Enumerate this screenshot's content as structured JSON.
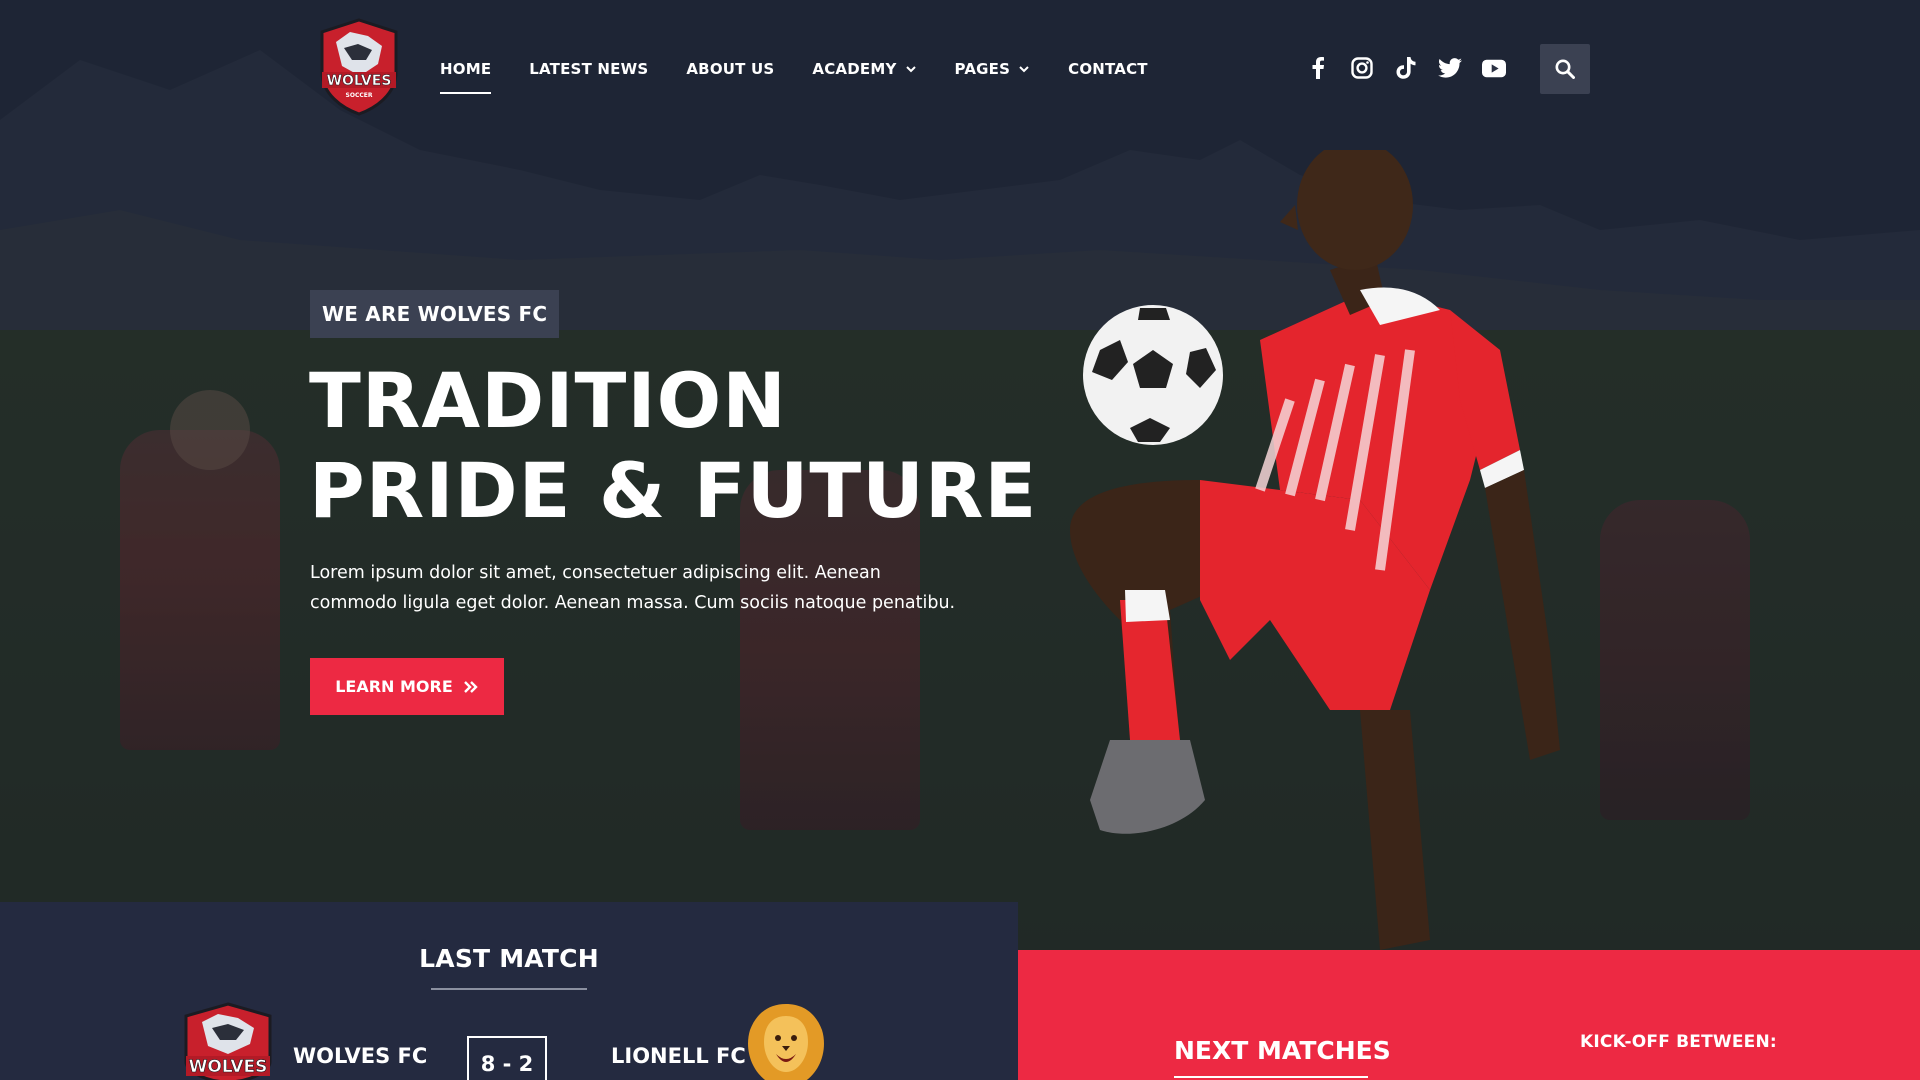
{
  "brand": {
    "logo_text": "WOLVES",
    "logo_subtext": "SOCCER",
    "accent": "#ed2943",
    "navy": "#242a40"
  },
  "nav": {
    "items": [
      {
        "label": "HOME",
        "active": true,
        "dropdown": false
      },
      {
        "label": "LATEST NEWS",
        "active": false,
        "dropdown": false
      },
      {
        "label": "ABOUT US",
        "active": false,
        "dropdown": false
      },
      {
        "label": "ACADEMY",
        "active": false,
        "dropdown": true
      },
      {
        "label": "PAGES",
        "active": false,
        "dropdown": true
      },
      {
        "label": "CONTACT",
        "active": false,
        "dropdown": false
      }
    ]
  },
  "socials": [
    "facebook-icon",
    "instagram-icon",
    "tiktok-icon",
    "twitter-icon",
    "youtube-icon"
  ],
  "hero": {
    "tagline": "WE ARE WOLVES FC",
    "headline_line1": "TRADITION",
    "headline_line2": "PRIDE & FUTURE",
    "lead": "Lorem ipsum dolor sit amet, consectetuer adipiscing elit. Aenean commodo ligula eget dolor. Aenean massa. Cum sociis natoque penatibu.",
    "cta_label": "LEARN MORE"
  },
  "last_match": {
    "title": "LAST MATCH",
    "home_team": "WOLVES FC",
    "score": "8 - 2",
    "away_team": "LIONELL FC"
  },
  "next_matches": {
    "title": "NEXT MATCHES",
    "kickoff_label": "KICK-OFF BETWEEN:"
  }
}
